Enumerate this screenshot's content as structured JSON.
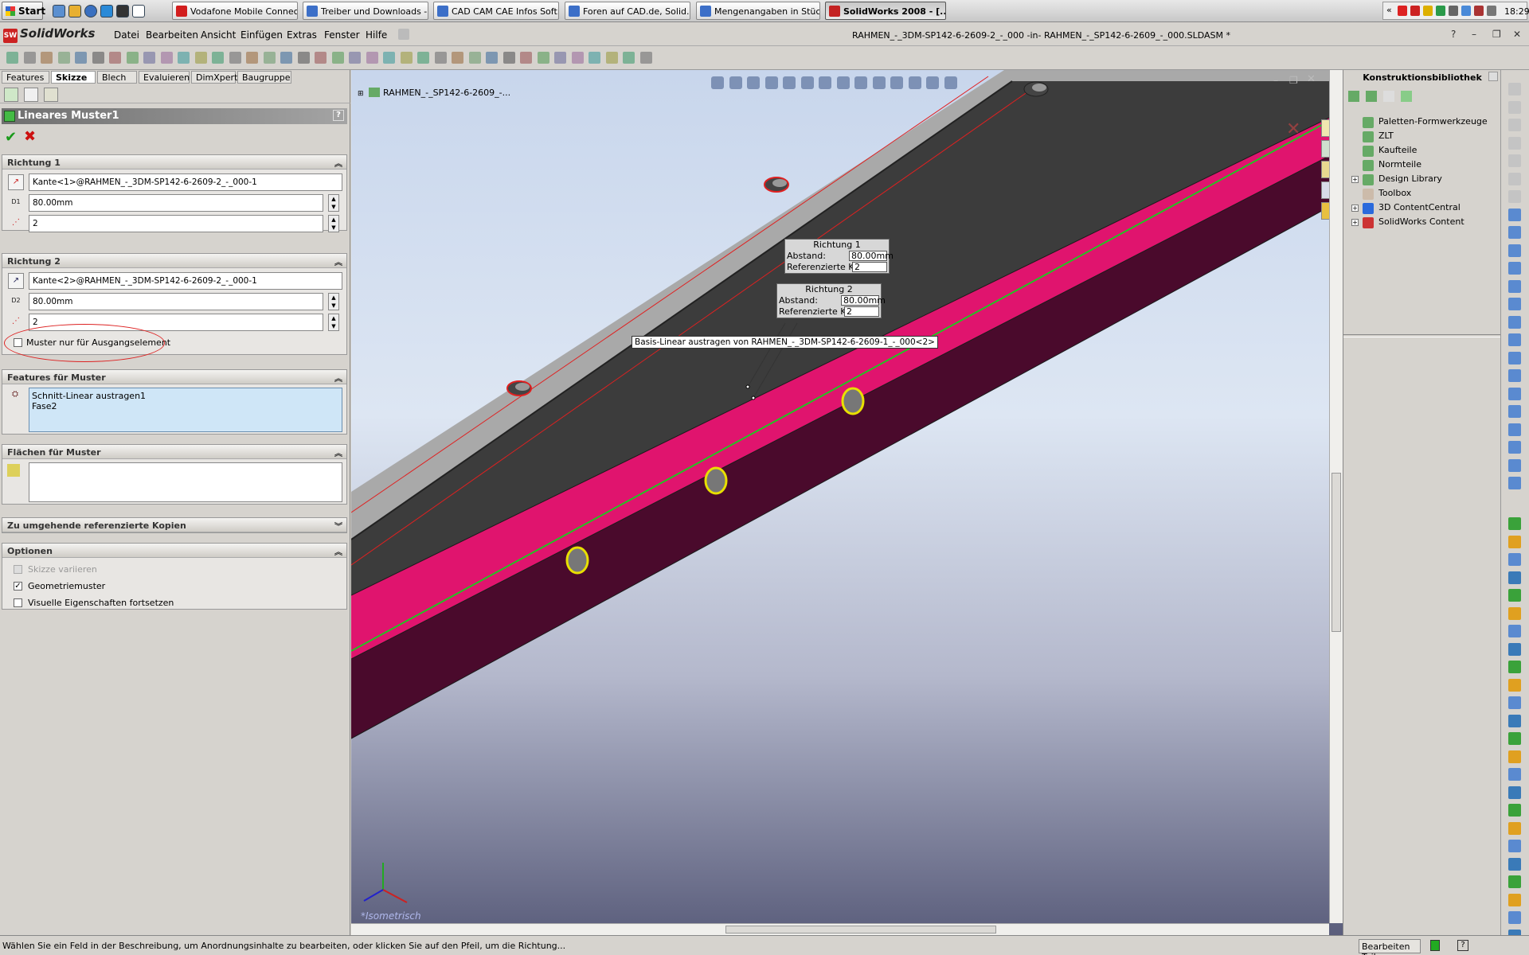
{
  "taskbar": {
    "start_label": "Start",
    "windows": [
      {
        "label": "Vodafone Mobile Connect",
        "color": "#d21e1e"
      },
      {
        "label": "Treiber und Downloads - ...",
        "color": "#3c6fc8"
      },
      {
        "label": "CAD CAM CAE Infos Soft...",
        "color": "#3c6fc8"
      },
      {
        "label": "Foren auf CAD.de, Solid...",
        "color": "#3c6fc8"
      },
      {
        "label": "Mengenangaben in Stück...",
        "color": "#3c6fc8"
      },
      {
        "label": "SolidWorks 2008 - [...",
        "color": "#c42222"
      }
    ],
    "clock": "18:29"
  },
  "app": {
    "brand": "SolidWorks",
    "menus": [
      "Datei",
      "Bearbeiten",
      "Ansicht",
      "Einfügen",
      "Extras",
      "Fenster",
      "Hilfe"
    ],
    "document_title": "RAHMEN_-_3DM-SP142-6-2609-2_-_000 -in- RAHMEN_-_SP142-6-2609_-_000.SLDASM *"
  },
  "manager_tabs": [
    "Features",
    "Skizze",
    "Blech",
    "Evaluieren",
    "DimXpert",
    "Baugruppe"
  ],
  "active_tab": "Skizze",
  "property_manager": {
    "title": "Lineares Muster1",
    "help": "?",
    "richtung1": {
      "heading": "Richtung 1",
      "edge": "Kante<1>@RAHMEN_-_3DM-SP142-6-2609-2_-_000-1",
      "distance": "80.00mm",
      "distance_icon": "D1",
      "copies": "2"
    },
    "richtung2": {
      "heading": "Richtung 2",
      "edge": "Kante<2>@RAHMEN_-_3DM-SP142-6-2609-2_-_000-1",
      "distance": "80.00mm",
      "distance_icon": "D2",
      "copies": "2",
      "seed_only_label": "Muster nur für Ausgangselement",
      "seed_only_checked": false
    },
    "features": {
      "heading": "Features für Muster",
      "items": [
        "Schnitt-Linear austragen1",
        "Fase2"
      ]
    },
    "faces": {
      "heading": "Flächen für Muster"
    },
    "skip": {
      "heading": "Zu umgehende referenzierte Kopien"
    },
    "options": {
      "heading": "Optionen",
      "items": [
        {
          "label": "Skizze variieren",
          "checked": false,
          "enabled": false
        },
        {
          "label": "Geometriemuster",
          "checked": true,
          "enabled": true
        },
        {
          "label": "Visuelle Eigenschaften fortsetzen",
          "checked": false,
          "enabled": true
        }
      ]
    }
  },
  "viewport": {
    "tree_item": "RAHMEN_-_SP142-6-2609_-...",
    "callout1": {
      "title": "Richtung 1",
      "dist_label": "Abstand:",
      "dist": "80.00mm",
      "copies_label": "Referenzierte Kopien:",
      "copies": "2"
    },
    "callout2": {
      "title": "Richtung 2",
      "dist_label": "Abstand:",
      "dist": "80.00mm",
      "copies_label": "Referenzierte Kopien:",
      "copies": "2"
    },
    "tooltip": "Basis-Linear austragen von RAHMEN_-_3DM-SP142-6-2609-1_-_000<2>",
    "view_label": "*Isometrisch",
    "colors": {
      "magenta": "#e0146e",
      "dark_face": "#4a0a2c",
      "green_edge": "#22c422",
      "red_edge": "#e02020",
      "grey_top": "#a6a6a6"
    }
  },
  "library": {
    "title": "Konstruktionsbibliothek",
    "items": [
      {
        "label": "Paletten-Formwerkzeuge",
        "expandable": false
      },
      {
        "label": "ZLT",
        "expandable": false
      },
      {
        "label": "Kaufteile",
        "expandable": false
      },
      {
        "label": "Normteile",
        "expandable": false
      },
      {
        "label": "Design Library",
        "expandable": true
      },
      {
        "label": "Toolbox",
        "expandable": false
      },
      {
        "label": "3D ContentCentral",
        "expandable": true
      },
      {
        "label": "SolidWorks Content",
        "expandable": true
      }
    ]
  },
  "status": {
    "message": "Wählen Sie ein Feld in der Beschreibung, um Anordnungsinhalte zu bearbeiten, oder klicken Sie auf den Pfeil, um die Richtung...",
    "mode": "Bearbeiten Teil"
  }
}
